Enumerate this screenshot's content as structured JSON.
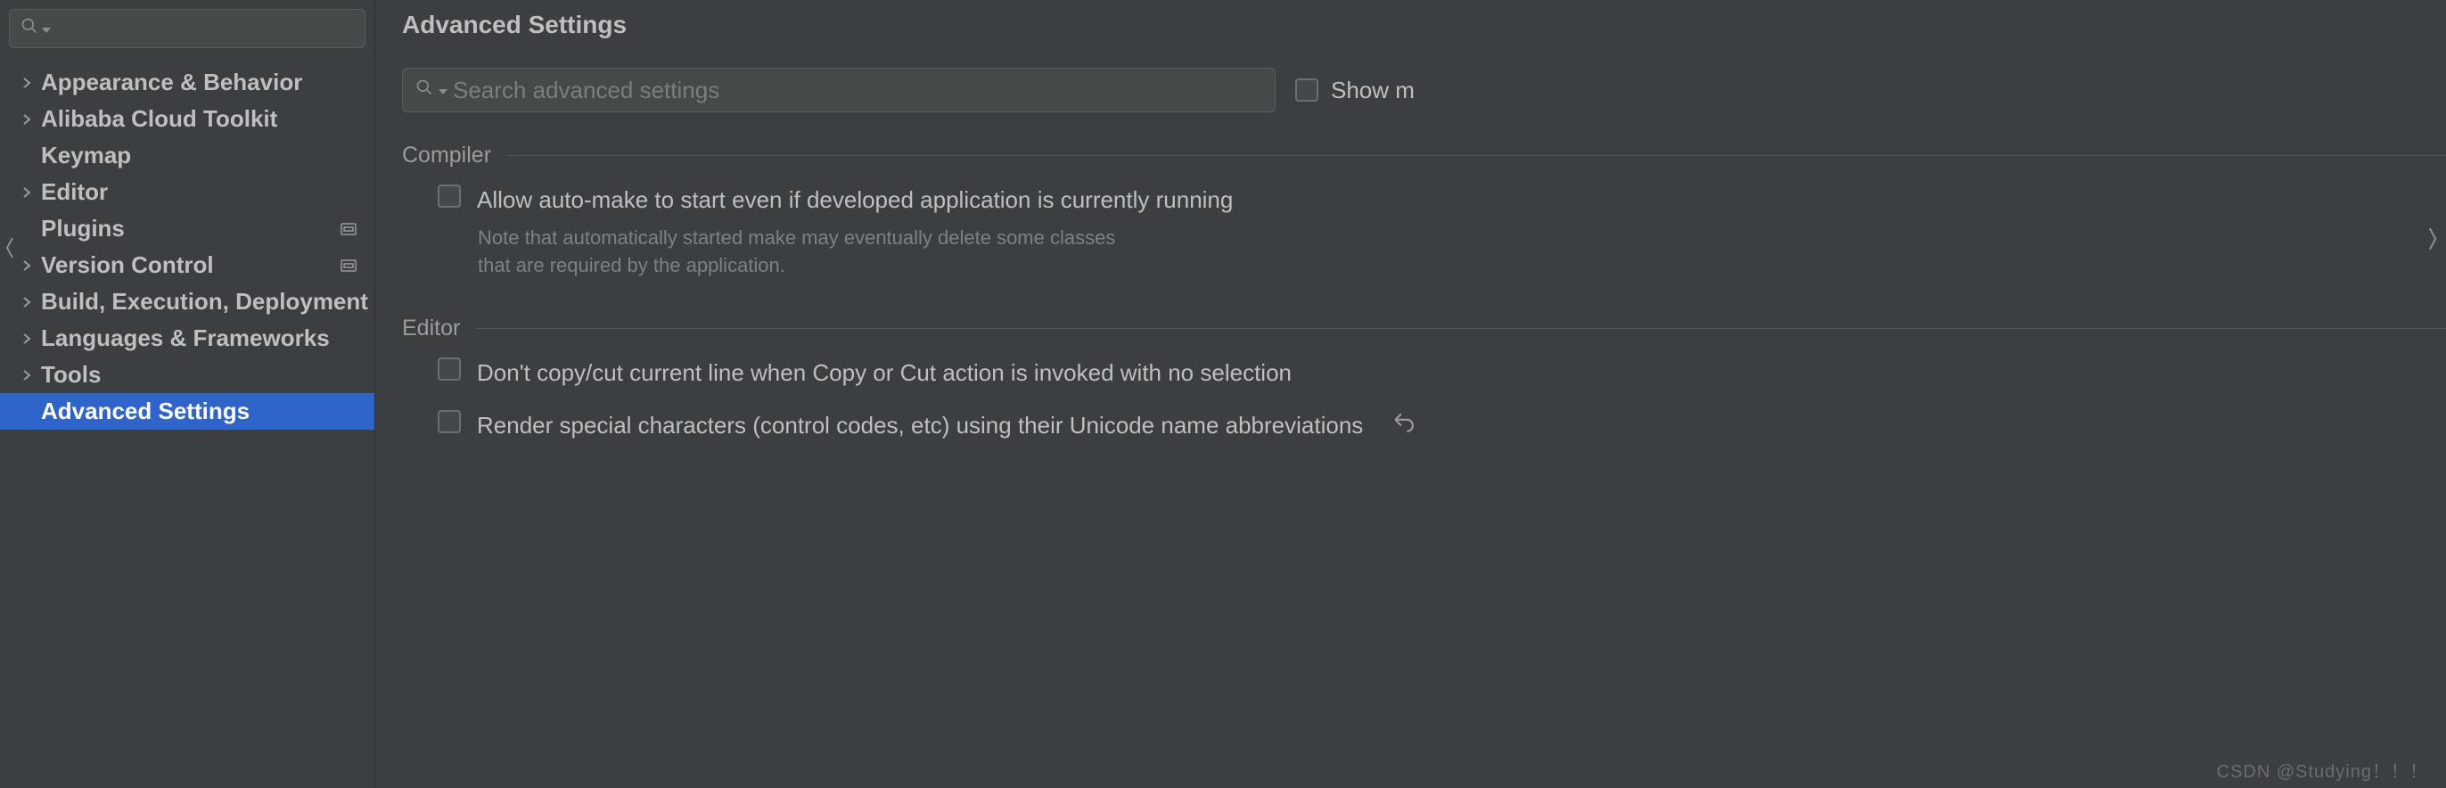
{
  "sidebar": {
    "items": [
      {
        "label": "Appearance & Behavior",
        "expandable": true
      },
      {
        "label": "Alibaba Cloud Toolkit",
        "expandable": true
      },
      {
        "label": "Keymap",
        "expandable": false
      },
      {
        "label": "Editor",
        "expandable": true
      },
      {
        "label": "Plugins",
        "expandable": false,
        "badge": true
      },
      {
        "label": "Version Control",
        "expandable": true,
        "badge": true
      },
      {
        "label": "Build, Execution, Deployment",
        "expandable": true
      },
      {
        "label": "Languages & Frameworks",
        "expandable": true
      },
      {
        "label": "Tools",
        "expandable": true
      },
      {
        "label": "Advanced Settings",
        "expandable": false,
        "selected": true
      }
    ]
  },
  "main": {
    "title": "Advanced Settings",
    "search_placeholder": "Search advanced settings",
    "show_modified": "Show m",
    "sections": {
      "compiler": {
        "title": "Compiler",
        "option1": "Allow auto-make to start even if developed application is currently running",
        "note1": "Note that automatically started make may eventually delete some classes that are required by the application."
      },
      "editor": {
        "title": "Editor",
        "option1": "Don't copy/cut current line when Copy or Cut action is invoked with no selection",
        "option2": "Render special characters (control codes, etc) using their Unicode name abbreviations"
      }
    }
  },
  "watermark": "CSDN @Studying！！！"
}
